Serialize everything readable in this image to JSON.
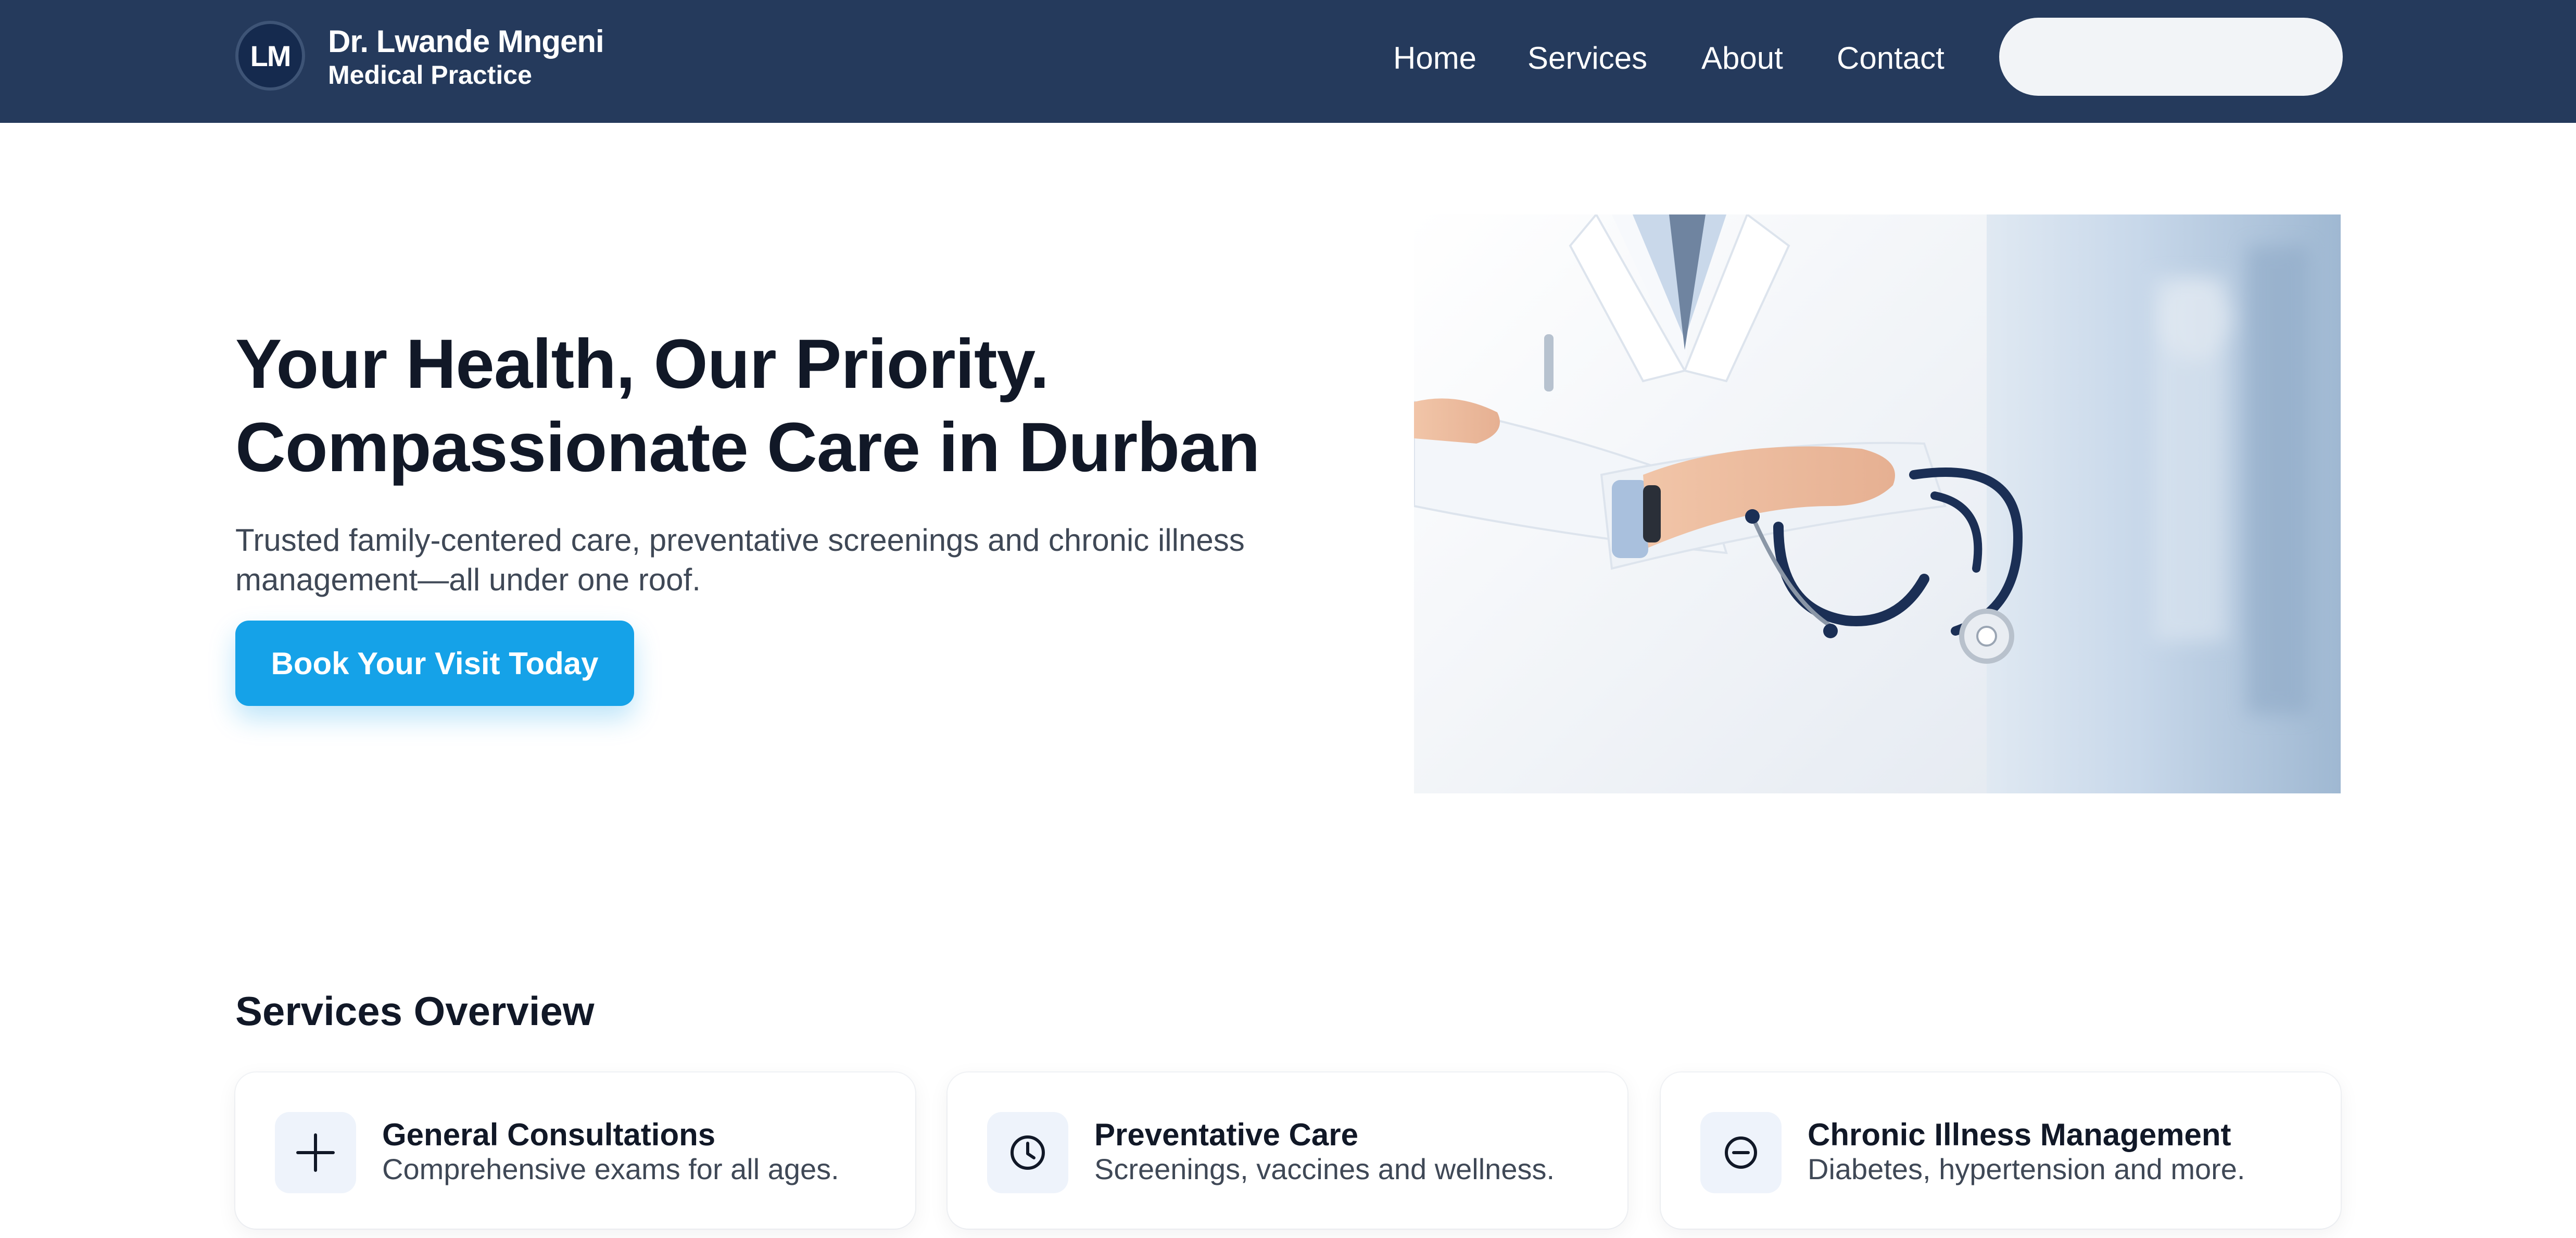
{
  "header": {
    "logo_initials": "LM",
    "brand_name": "Dr. Lwande Mngeni",
    "brand_subtitle": "Medical Practice",
    "nav": [
      {
        "label": "Home"
      },
      {
        "label": "Services"
      },
      {
        "label": "About"
      },
      {
        "label": "Contact"
      }
    ]
  },
  "hero": {
    "title_line1": "Your Health, Our Priority.",
    "title_line2": "Compassionate Care in Durban",
    "subtitle": "Trusted family-centered care, preventative screenings and chronic illness management—all under one roof.",
    "cta_label": "Book Your Visit Today",
    "image_icon": "doctor-with-stethoscope-photo"
  },
  "services": {
    "heading": "Services Overview",
    "items": [
      {
        "icon": "plus-icon",
        "title": "General Consultations",
        "description": "Comprehensive exams for all ages."
      },
      {
        "icon": "clock-icon",
        "title": "Preventative Care",
        "description": "Screenings, vaccines and wellness."
      },
      {
        "icon": "minus-circle-icon",
        "title": "Chronic Illness Management",
        "description": "Diabetes, hypertension and more."
      }
    ]
  },
  "colors": {
    "header_bg": "#253a5c",
    "accent": "#15a2e8",
    "text_dark": "#111827",
    "text_muted": "#3f4856"
  }
}
